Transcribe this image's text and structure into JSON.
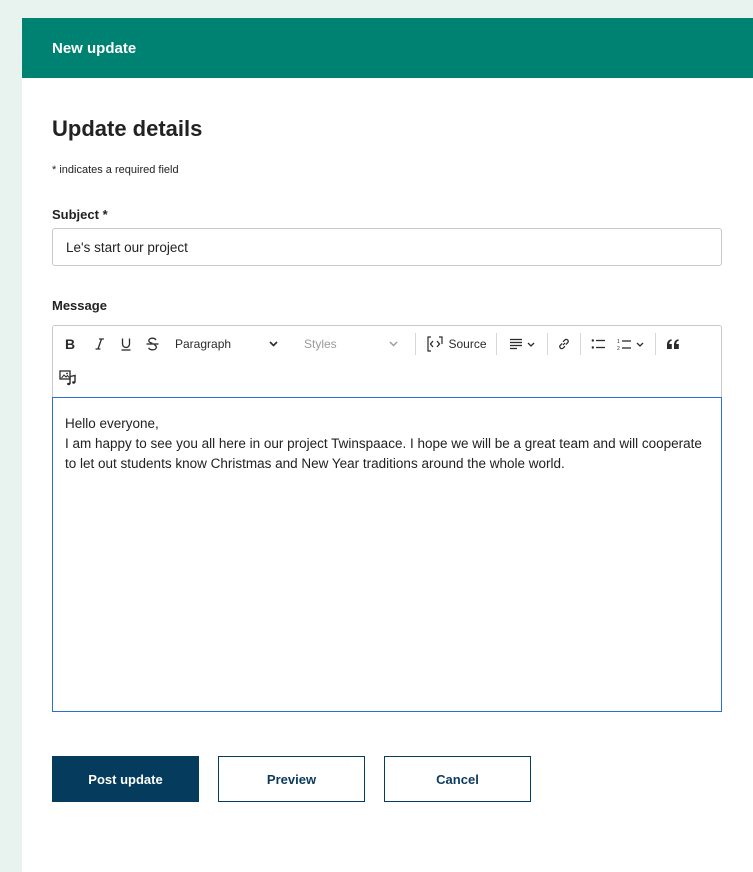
{
  "header": {
    "title": "New update"
  },
  "page": {
    "title": "Update details",
    "required_note": "* indicates a required field"
  },
  "subject": {
    "label": "Subject *",
    "value": "Le's start our project"
  },
  "message": {
    "label": "Message",
    "toolbar": {
      "items": [
        "bold-icon",
        "italic-icon",
        "underline-icon",
        "strikethrough-icon",
        "align-icon",
        "link-icon",
        "bulleted-list-icon",
        "numbered-list-icon",
        "blockquote-icon",
        "insert-media-icon"
      ],
      "paragraph_label": "Paragraph",
      "styles_label": "Styles",
      "source_label": "Source"
    },
    "body": {
      "line1": "Hello everyone,",
      "line2": "I am happy to see you all here in our project Twinspaace. I hope we will be a great team and will cooperate to let out students know Christmas and New Year traditions around the whole world."
    }
  },
  "actions": {
    "post_label": "Post update",
    "preview_label": "Preview",
    "cancel_label": "Cancel"
  },
  "colors": {
    "header": "#008272",
    "primary_button": "#053b5c",
    "focus_border": "#2b6fd6",
    "page_background": "#e8f2ef"
  }
}
